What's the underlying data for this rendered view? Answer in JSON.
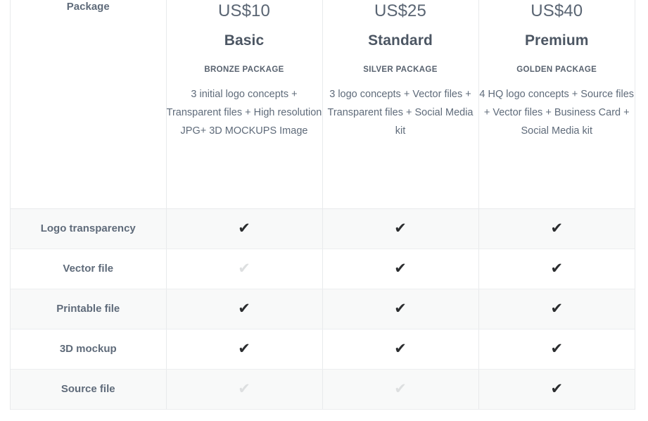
{
  "table": {
    "feature_column_header": "Package",
    "packages": [
      {
        "price": "US$10",
        "tier": "Basic",
        "kicker": "BRONZE PACKAGE",
        "description": "3 initial logo concepts + Transparent files + High resolution JPG+ 3D MOCKUPS Image"
      },
      {
        "price": "US$25",
        "tier": "Standard",
        "kicker": "SILVER PACKAGE",
        "description": "3 logo concepts + Vector files + Transparent files + Social Media kit"
      },
      {
        "price": "US$40",
        "tier": "Premium",
        "kicker": "GOLDEN PACKAGE",
        "description": "4 HQ logo concepts + Source files + Vector files + Business Card + Social Media kit"
      }
    ],
    "features": [
      {
        "name": "Logo transparency",
        "values": [
          "included",
          "included",
          "included"
        ]
      },
      {
        "name": "Vector file",
        "values": [
          "excluded",
          "included",
          "included"
        ]
      },
      {
        "name": "Printable file",
        "values": [
          "included",
          "included",
          "included"
        ]
      },
      {
        "name": "3D mockup",
        "values": [
          "included",
          "included",
          "included"
        ]
      },
      {
        "name": "Source file",
        "values": [
          "excluded",
          "excluded",
          "included"
        ]
      }
    ],
    "icons": {
      "check": "✔"
    },
    "colors": {
      "check_included": "#2b2d2f",
      "check_excluded": "#dddfe0",
      "text": "#5f6b7a",
      "heading": "#4c5663",
      "row_shaded": "#f8f9f9",
      "border": "#e8eaec"
    }
  }
}
